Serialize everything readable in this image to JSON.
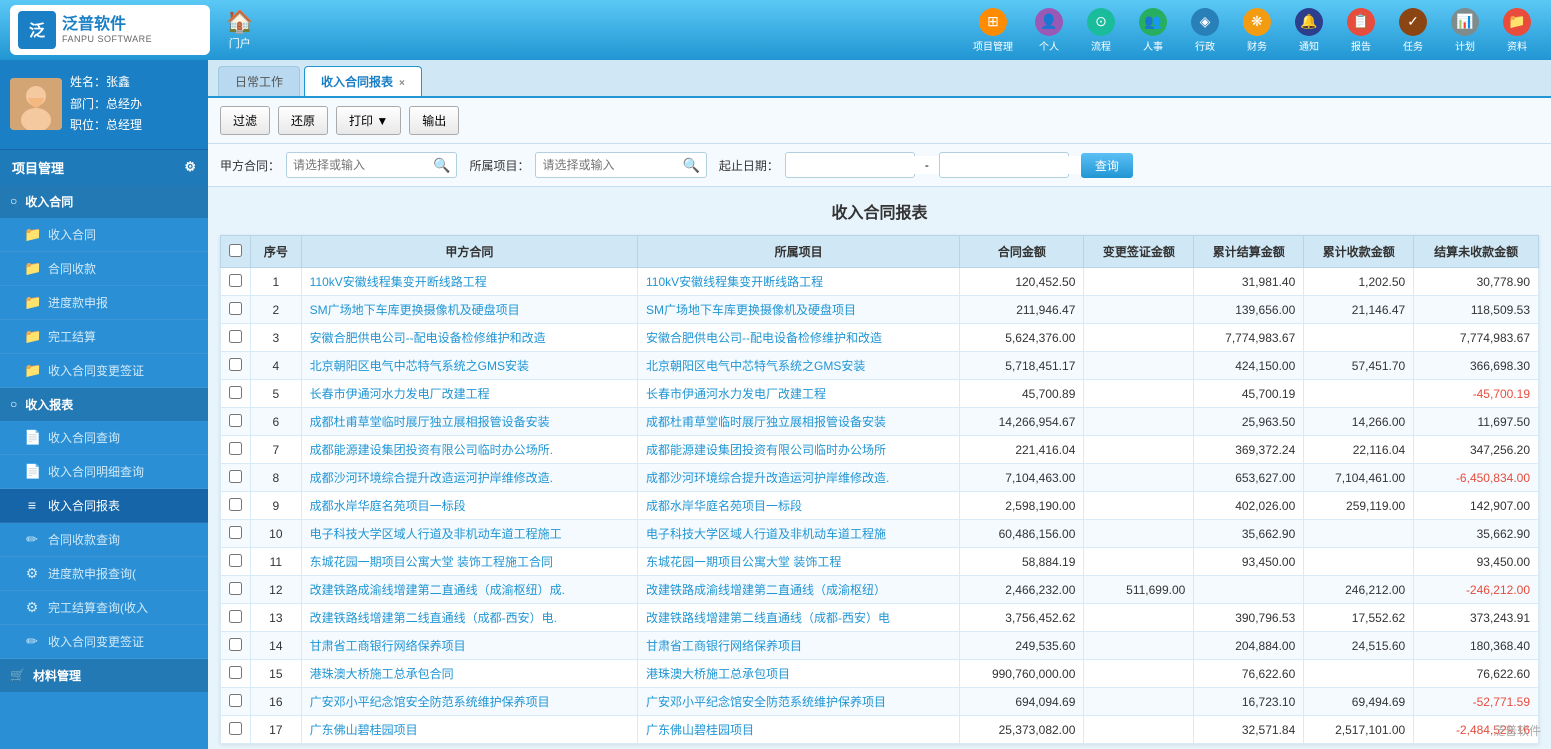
{
  "brand": {
    "logo_cn": "泛普软件",
    "logo_en": "FANPU SOFTWARE"
  },
  "top_nav": {
    "home_label": "门户",
    "items": [
      {
        "label": "项目管理",
        "icon": "⊞",
        "icon_class": "icon-orange"
      },
      {
        "label": "个人",
        "icon": "👤",
        "icon_class": "icon-purple"
      },
      {
        "label": "流程",
        "icon": "⊙",
        "icon_class": "icon-teal"
      },
      {
        "label": "人事",
        "icon": "👥",
        "icon_class": "icon-green"
      },
      {
        "label": "行政",
        "icon": "◈",
        "icon_class": "icon-blue2"
      },
      {
        "label": "财务",
        "icon": "❋",
        "icon_class": "icon-yellow"
      },
      {
        "label": "通知",
        "icon": "🔔",
        "icon_class": "icon-darkblue"
      },
      {
        "label": "报告",
        "icon": "📋",
        "icon_class": "icon-red"
      },
      {
        "label": "任务",
        "icon": "✓",
        "icon_class": "icon-brown"
      },
      {
        "label": "计划",
        "icon": "📊",
        "icon_class": "icon-gray"
      },
      {
        "label": "资料",
        "icon": "📁",
        "icon_class": "icon-red"
      }
    ]
  },
  "user": {
    "name_label": "姓名：张鑫",
    "dept_label": "部门：总经办",
    "role_label": "职位：总经理"
  },
  "sidebar": {
    "section_title": "项目管理",
    "items": [
      {
        "label": "收入合同",
        "icon": "○",
        "type": "parent",
        "indent": 0
      },
      {
        "label": "收入合同",
        "icon": "📁",
        "type": "child",
        "indent": 1
      },
      {
        "label": "合同收款",
        "icon": "📁",
        "type": "child",
        "indent": 1
      },
      {
        "label": "进度款申报",
        "icon": "📁",
        "type": "child",
        "indent": 1
      },
      {
        "label": "完工结算",
        "icon": "📁",
        "type": "child",
        "indent": 1
      },
      {
        "label": "收入合同变更签证",
        "icon": "📁",
        "type": "child",
        "indent": 1
      },
      {
        "label": "收入报表",
        "icon": "○",
        "type": "parent",
        "indent": 0
      },
      {
        "label": "收入合同查询",
        "icon": "📄",
        "type": "child",
        "indent": 1
      },
      {
        "label": "收入合同明细查询",
        "icon": "📄",
        "type": "child",
        "indent": 1
      },
      {
        "label": "收入合同报表",
        "icon": "≡",
        "type": "child",
        "active": true,
        "indent": 1
      },
      {
        "label": "合同收款查询",
        "icon": "✏",
        "type": "child",
        "indent": 1
      },
      {
        "label": "进度款申报查询(",
        "icon": "⚙",
        "type": "child",
        "indent": 1
      },
      {
        "label": "完工结算查询(收入",
        "icon": "⚙",
        "type": "child",
        "indent": 1
      },
      {
        "label": "收入合同变更签证",
        "icon": "✏",
        "type": "child",
        "indent": 1
      },
      {
        "label": "材料管理",
        "icon": "🛒",
        "type": "parent",
        "indent": 0
      }
    ]
  },
  "tabs": [
    {
      "label": "日常工作",
      "active": false,
      "closable": false
    },
    {
      "label": "收入合同报表",
      "active": true,
      "closable": true
    }
  ],
  "toolbar": {
    "filter_label": "过滤",
    "reset_label": "还原",
    "print_label": "打印 ▼",
    "export_label": "输出"
  },
  "filter": {
    "contract_label": "甲方合同：",
    "contract_placeholder": "请选择或输入",
    "project_label": "所属项目：",
    "project_placeholder": "请选择或输入",
    "date_start_label": "起止日期：",
    "date_separator": "-",
    "query_label": "查询"
  },
  "report_title": "收入合同报表",
  "table": {
    "headers": [
      "",
      "序号",
      "甲方合同",
      "所属项目",
      "合同金额",
      "变更签证金额",
      "累计结算金额",
      "累计收款金额",
      "结算未收款金额"
    ],
    "rows": [
      {
        "seq": "1",
        "contract": "110kV安徽线程集变开断线路工程",
        "project": "110kV安徽线程集变开断线路工程",
        "amount": "120,452.50",
        "change": "",
        "settled": "31,981.40",
        "received": "1,202.50",
        "unsettled": "30,778.90"
      },
      {
        "seq": "2",
        "contract": "SM广场地下车库更换摄像机及硬盘项目",
        "project": "SM广场地下车库更换摄像机及硬盘项目",
        "amount": "211,946.47",
        "change": "",
        "settled": "139,656.00",
        "received": "21,146.47",
        "unsettled": "118,509.53"
      },
      {
        "seq": "3",
        "contract": "安徽合肥供电公司--配电设备检修维护和改造",
        "project": "安徽合肥供电公司--配电设备检修维护和改造",
        "amount": "5,624,376.00",
        "change": "",
        "settled": "7,774,983.67",
        "received": "",
        "unsettled": "7,774,983.67"
      },
      {
        "seq": "4",
        "contract": "北京朝阳区电气中芯特气系统之GMS安装",
        "project": "北京朝阳区电气中芯特气系统之GMS安装",
        "amount": "5,718,451.17",
        "change": "",
        "settled": "424,150.00",
        "received": "57,451.70",
        "unsettled": "366,698.30"
      },
      {
        "seq": "5",
        "contract": "长春市伊通河水力发电厂改建工程",
        "project": "长春市伊通河水力发电厂改建工程",
        "amount": "45,700.89",
        "change": "",
        "settled": "45,700.19",
        "received": "",
        "unsettled": "-45,700.19",
        "unsettled_red": true
      },
      {
        "seq": "6",
        "contract": "成都杜甫草堂临时展厅独立展相报管设备安装",
        "project": "成都杜甫草堂临时展厅独立展相报管设备安装",
        "amount": "14,266,954.67",
        "change": "",
        "settled": "25,963.50",
        "received": "14,266.00",
        "unsettled": "11,697.50"
      },
      {
        "seq": "7",
        "contract": "成都能源建设集团投资有限公司临时办公场所.",
        "project": "成都能源建设集团投资有限公司临时办公场所",
        "amount": "221,416.04",
        "change": "",
        "settled": "369,372.24",
        "received": "22,116.04",
        "unsettled": "347,256.20"
      },
      {
        "seq": "8",
        "contract": "成都沙河环境综合提升改造运河护岸维修改造.",
        "project": "成都沙河环境综合提升改造运河护岸维修改造.",
        "amount": "7,104,463.00",
        "change": "",
        "settled": "653,627.00",
        "received": "7,104,461.00",
        "unsettled": "-6,450,834.00",
        "unsettled_red": true
      },
      {
        "seq": "9",
        "contract": "成都水岸华庭名苑项目一标段",
        "project": "成都水岸华庭名苑项目一标段",
        "amount": "2,598,190.00",
        "change": "",
        "settled": "402,026.00",
        "received": "259,119.00",
        "unsettled": "142,907.00"
      },
      {
        "seq": "10",
        "contract": "电子科技大学区域人行道及非机动车道工程施工",
        "project": "电子科技大学区域人行道及非机动车道工程施",
        "amount": "60,486,156.00",
        "change": "",
        "settled": "35,662.90",
        "received": "",
        "unsettled": "35,662.90"
      },
      {
        "seq": "11",
        "contract": "东城花园一期项目公寓大堂 装饰工程施工合同",
        "project": "东城花园一期项目公寓大堂 装饰工程",
        "amount": "58,884.19",
        "change": "",
        "settled": "93,450.00",
        "received": "",
        "unsettled": "93,450.00"
      },
      {
        "seq": "12",
        "contract": "改建铁路成渝线增建第二直通线（成渝枢纽）成.",
        "project": "改建铁路成渝线增建第二直通线（成渝枢纽）",
        "amount": "2,466,232.00",
        "change": "511,699.00",
        "settled": "",
        "received": "246,212.00",
        "unsettled": "-246,212.00",
        "unsettled_red": true
      },
      {
        "seq": "13",
        "contract": "改建铁路线增建第二线直通线（成都-西安）电.",
        "project": "改建铁路线增建第二线直通线（成都-西安）电",
        "amount": "3,756,452.62",
        "change": "",
        "settled": "390,796.53",
        "received": "17,552.62",
        "unsettled": "373,243.91"
      },
      {
        "seq": "14",
        "contract": "甘肃省工商银行网络保养项目",
        "project": "甘肃省工商银行网络保养项目",
        "amount": "249,535.60",
        "change": "",
        "settled": "204,884.00",
        "received": "24,515.60",
        "unsettled": "180,368.40"
      },
      {
        "seq": "15",
        "contract": "港珠澳大桥施工总承包合同",
        "project": "港珠澳大桥施工总承包项目",
        "amount": "990,760,000.00",
        "change": "",
        "settled": "76,622.60",
        "received": "",
        "unsettled": "76,622.60"
      },
      {
        "seq": "16",
        "contract": "广安邓小平纪念馆安全防范系统维护保养项目",
        "project": "广安邓小平纪念馆安全防范系统维护保养项目",
        "amount": "694,094.69",
        "change": "",
        "settled": "16,723.10",
        "received": "69,494.69",
        "unsettled": "-52,771.59",
        "unsettled_red": true
      },
      {
        "seq": "17",
        "contract": "广东佛山碧桂园项目",
        "project": "广东佛山碧桂园项目",
        "amount": "25,373,082.00",
        "change": "",
        "settled": "32,571.84",
        "received": "2,517,101.00",
        "unsettled": "-2,484,529.16",
        "unsettled_red": true
      }
    ]
  }
}
